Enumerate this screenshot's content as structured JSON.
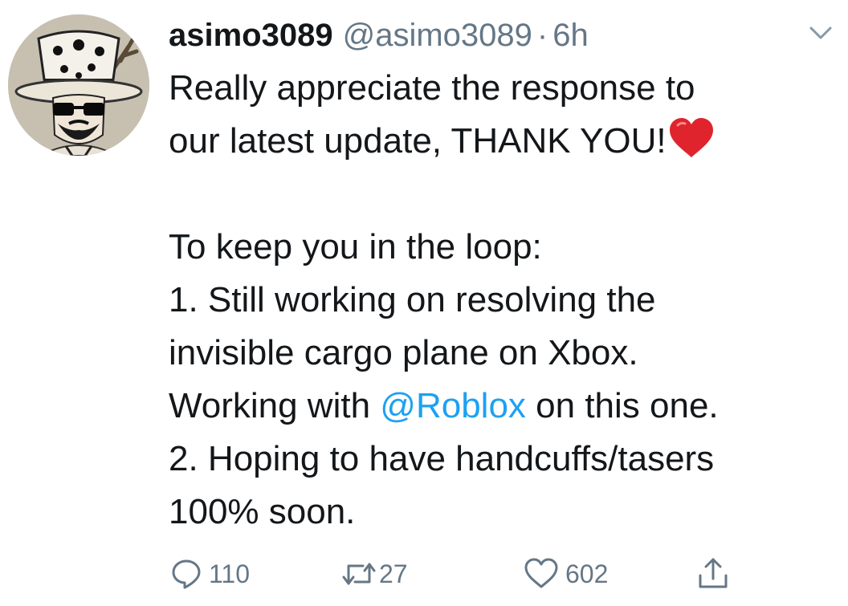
{
  "tweet": {
    "display_name": "asimo3089",
    "handle": "@asimo3089",
    "separator": "·",
    "timestamp": "6h",
    "lines": {
      "l1": "Really appreciate the response to",
      "l2": "our latest update, THANK YOU!",
      "l4": "To keep you in the loop:",
      "l5": "1. Still working on resolving the",
      "l6": "invisible cargo plane on Xbox.",
      "l7_before": "Working with ",
      "l7_mention": "@Roblox",
      "l7_after": " on this one.",
      "l8": "2. Hoping to have handcuffs/tasers",
      "l9": "100% soon."
    }
  },
  "actions": {
    "reply_count": "110",
    "retweet_count": "27",
    "like_count": "602"
  },
  "icons": {
    "avatar": "avatar-image",
    "more": "chevron-down-icon",
    "emoji": "red-heart-emoji",
    "reply": "reply-icon",
    "retweet": "retweet-icon",
    "like": "heart-icon",
    "share": "share-icon"
  },
  "colors": {
    "text": "#14171a",
    "secondary": "#657786",
    "link": "#1da1f2",
    "emoji_heart": "#e0242e"
  }
}
